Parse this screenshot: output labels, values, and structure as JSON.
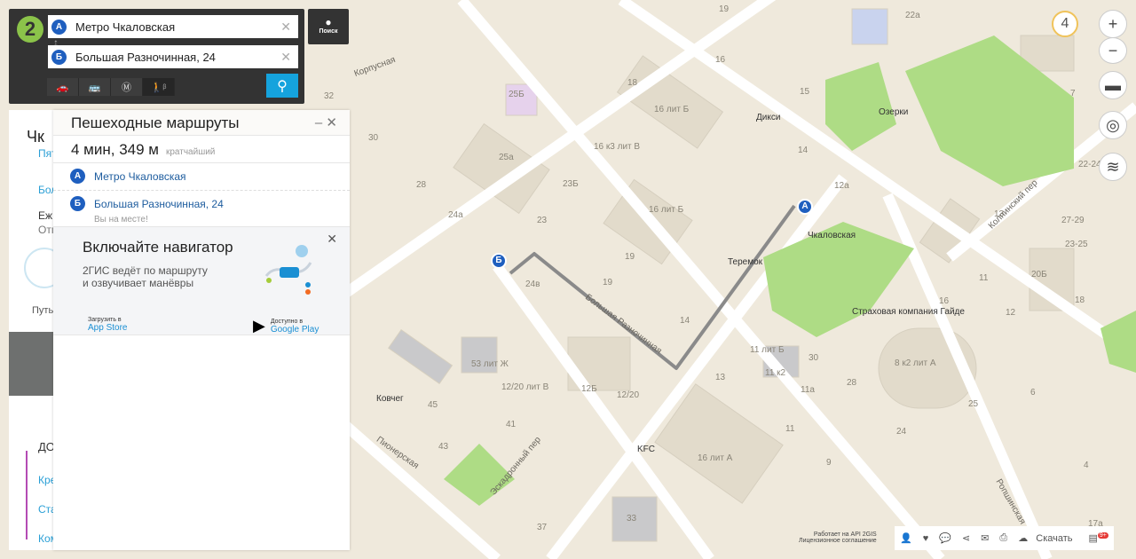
{
  "search": {
    "from": "Метро Чкаловская",
    "to": "Большая Разночинная, 24",
    "from_badge": "А",
    "to_badge": "Б",
    "search_button": "Поиск",
    "modes": [
      "car",
      "bus",
      "metro",
      "walk"
    ],
    "walk_beta": "β"
  },
  "route_panel": {
    "title": "Пешеходные маршруты",
    "summary": "4 мин, 349 м",
    "summary_tag": "кратчайший",
    "points": [
      {
        "badge": "А",
        "name": "Метро Чкаловская"
      },
      {
        "badge": "Б",
        "name": "Большая Разночинная, 24",
        "note": "Вы на месте!"
      }
    ]
  },
  "promo": {
    "title": "Включайте навигатор",
    "text1": "2ГИС ведёт по маршруту",
    "text2": "и озвучивает манёвры",
    "appstore_small": "Загрузить в",
    "appstore": "App Store",
    "gplay_small": "Доступно в",
    "gplay": "Google Play"
  },
  "back_panel": {
    "title": "Чк",
    "link": "Пят",
    "item1": "Бол",
    "item2": "Еж",
    "item2b": "Отп",
    "path": "Путь",
    "section": "ДО",
    "stops": [
      "Кре",
      "Ста",
      "Ком"
    ]
  },
  "map": {
    "zoom_level": "4",
    "pois": [
      "Дикси",
      "Озерки",
      "Чкаловская",
      "Теремок",
      "Страховая компания Гайде",
      "Ковчег",
      "KFC"
    ],
    "streets": [
      "Корпусная",
      "Большая Разночинная",
      "Пионерская",
      "Эскадронный пер",
      "Ропшинская",
      "Колпинский пер"
    ],
    "numbers": [
      "19",
      "16",
      "18",
      "15",
      "22а",
      "25Б",
      "16 лит Б",
      "16 к3 лит В",
      "14",
      "12а",
      "25а",
      "23Б",
      "16 лит Б",
      "23",
      "19",
      "24а",
      "24в",
      "19",
      "14",
      "53 лит Ж",
      "12/20 лит В",
      "12Б",
      "12/20",
      "41",
      "45",
      "43",
      "37",
      "33",
      "13",
      "11 лит Б",
      "11 к2",
      "11а",
      "30",
      "28",
      "8 к2 лит А",
      "16 лит А",
      "11",
      "9",
      "24",
      "25",
      "6",
      "4",
      "32",
      "30",
      "28",
      "20Б",
      "18",
      "16",
      "12",
      "11",
      "13",
      "22-24",
      "27-29",
      "23-25",
      "17а",
      "7"
    ]
  },
  "footer": {
    "api": "Работает на API 2GIS",
    "license": "Лицензионное соглашение",
    "download": "Скачать",
    "badge": "9+"
  },
  "colors": {
    "accent": "#15a3dd",
    "route": "#8a8a8a",
    "badge": "#1f5fbf",
    "park": "#aedc85"
  }
}
